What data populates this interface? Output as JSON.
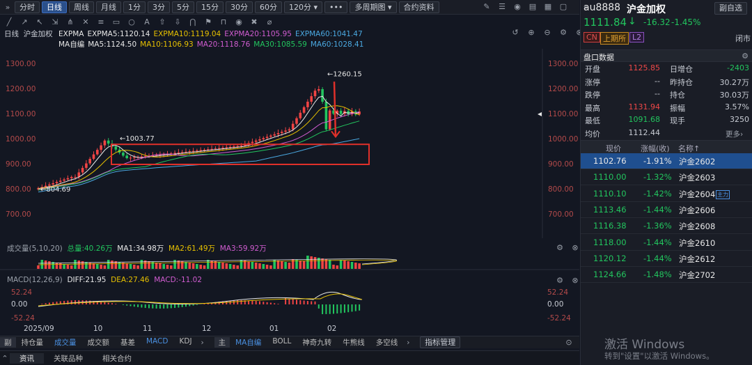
{
  "toolbar": {
    "expand": "»",
    "items": [
      "分时",
      "日线",
      "周线",
      "月线",
      "1分",
      "3分",
      "5分",
      "15分",
      "30分",
      "60分",
      "120分 ▾",
      "•••",
      "多周期图 ▾",
      "合约资料"
    ],
    "active": 1
  },
  "legend_main": {
    "period": "日线",
    "name": "沪金加权",
    "expma": [
      {
        "t": "EXPMA",
        "c": "#e8e8e8"
      },
      {
        "t": "EXPMA5:1120.14",
        "c": "#e8e8e8"
      },
      {
        "t": "EXPMA10:1119.04",
        "c": "#e6c000"
      },
      {
        "t": "EXPMA20:1105.95",
        "c": "#d05cd0"
      },
      {
        "t": "EXPMA60:1041.47",
        "c": "#4aa8e0"
      }
    ],
    "ma": [
      {
        "t": "MA自编",
        "c": "#e8e8e8"
      },
      {
        "t": "MA5:1124.50",
        "c": "#e8e8e8"
      },
      {
        "t": "MA10:1106.93",
        "c": "#e6c000"
      },
      {
        "t": "MA20:1118.76",
        "c": "#d05cd0"
      },
      {
        "t": "MA30:1085.59",
        "c": "#22c55e"
      },
      {
        "t": "MA60:1028.41",
        "c": "#4aa8e0"
      }
    ]
  },
  "price_axis": [
    "1300.00",
    "1200.00",
    "1100.00",
    "1000.00",
    "900.00",
    "800.00",
    "700.00"
  ],
  "annotations": {
    "high": "1260.15",
    "mid": "1003.77",
    "low": "804.69"
  },
  "volume": {
    "title": "成交量(5,10,20)",
    "total": "总量:40.26万",
    "ma1": "MA1:34.98万",
    "ma2": "MA2:61.49万",
    "ma3": "MA3:59.92万"
  },
  "macd": {
    "title": "MACD(12,26,9)",
    "diff": "DIFF:21.95",
    "dea": "DEA:27.46",
    "macd": "MACD:-11.02",
    "axis": [
      "52.24",
      "0.00",
      "-52.24"
    ]
  },
  "x_axis": [
    "2025/09",
    "10",
    "11",
    "12",
    "01",
    "02"
  ],
  "bottom_left": {
    "label": "副",
    "tabs": [
      "持仓量",
      "成交量",
      "成交额",
      "基差",
      "MACD",
      "KDJ"
    ]
  },
  "bottom_right": {
    "label": "主",
    "tabs": [
      "MA自编",
      "BOLL",
      "神奇九转",
      "牛熊线",
      "多空线"
    ],
    "mgr": "指标管理"
  },
  "footer": {
    "tabs": [
      "资讯",
      "关联品种",
      "相关合约"
    ]
  },
  "quote": {
    "code": "au8888",
    "name": "沪金加权",
    "fav": "副自选",
    "price": "1111.84",
    "arrow": "↓",
    "chg": "-16.32",
    "pct": "-1.45%",
    "tags": [
      "CN",
      "上期所",
      "L2"
    ],
    "status": "闭市"
  },
  "panel_title": "盘口数据",
  "stats": [
    {
      "k1": "开盘",
      "v1": "1125.85",
      "c1": "red",
      "k2": "日增仓",
      "v2": "-2403",
      "c2": "grn"
    },
    {
      "k1": "涨停",
      "v1": "--",
      "c1": "",
      "k2": "昨持仓",
      "v2": "30.27万",
      "c2": ""
    },
    {
      "k1": "跌停",
      "v1": "--",
      "c1": "",
      "k2": "持仓",
      "v2": "30.03万",
      "c2": ""
    },
    {
      "k1": "最高",
      "v1": "1131.94",
      "c1": "red",
      "k2": "振幅",
      "v2": "3.57%",
      "c2": ""
    },
    {
      "k1": "最低",
      "v1": "1091.68",
      "c1": "grn",
      "k2": "现手",
      "v2": "3250",
      "c2": ""
    },
    {
      "k1": "均价",
      "v1": "1112.44",
      "c1": "",
      "k2": "",
      "v2": "",
      "c2": ""
    }
  ],
  "more": "更多›",
  "table_head": [
    "现价",
    "涨幅(收)",
    "名称↑"
  ],
  "contracts": [
    {
      "p": "1102.76",
      "r": "-1.91%",
      "n": "沪金2602",
      "tag": ""
    },
    {
      "p": "1110.00",
      "r": "-1.32%",
      "n": "沪金2603",
      "tag": ""
    },
    {
      "p": "1110.10",
      "r": "-1.42%",
      "n": "沪金2604",
      "tag": "主力"
    },
    {
      "p": "1113.46",
      "r": "-1.44%",
      "n": "沪金2606",
      "tag": ""
    },
    {
      "p": "1116.38",
      "r": "-1.36%",
      "n": "沪金2608",
      "tag": ""
    },
    {
      "p": "1118.00",
      "r": "-1.44%",
      "n": "沪金2610",
      "tag": ""
    },
    {
      "p": "1120.12",
      "r": "-1.44%",
      "n": "沪金2612",
      "tag": ""
    },
    {
      "p": "1124.66",
      "r": "-1.48%",
      "n": "沪金2702",
      "tag": ""
    }
  ],
  "watermark": {
    "line1": "激活 Windows",
    "line2": "转到\"设置\"以激活 Windows。"
  }
}
